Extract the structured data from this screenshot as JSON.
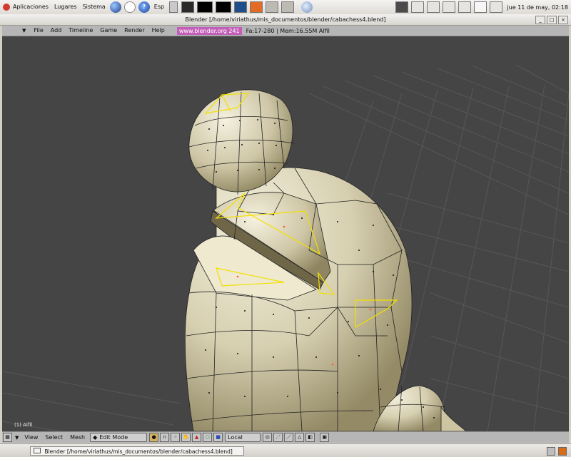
{
  "top_panel": {
    "menus": [
      "Aplicaciones",
      "Lugares",
      "Sistema"
    ],
    "lang": "Esp",
    "clock": "jue 11 de may, 02:18"
  },
  "window": {
    "title": "Blender [/home/viriathus/mis_documentos/blender/cabachess4.blend]",
    "controls": [
      "_",
      "□",
      "×"
    ]
  },
  "menubar": {
    "items": [
      "File",
      "Add",
      "Timeline",
      "Game",
      "Render",
      "Help"
    ],
    "url": "www.blender.org 241",
    "stats": "Fa:17-280 | Mem:16.55M Alfil"
  },
  "viewport": {
    "object_label": "(1) Alfil",
    "background_color": "#454545",
    "grid_color": "#5a5a5a",
    "mesh_color": "#d8d2b4",
    "selection_color": "#f2e000"
  },
  "header_3d": {
    "menus": [
      "View",
      "Select",
      "Mesh"
    ],
    "mode": "Edit Mode",
    "orientation": "Local"
  },
  "taskbar": {
    "task_title": "Blender [/home/viriathus/mis_documentos/blender/cabachess4.blend]"
  }
}
